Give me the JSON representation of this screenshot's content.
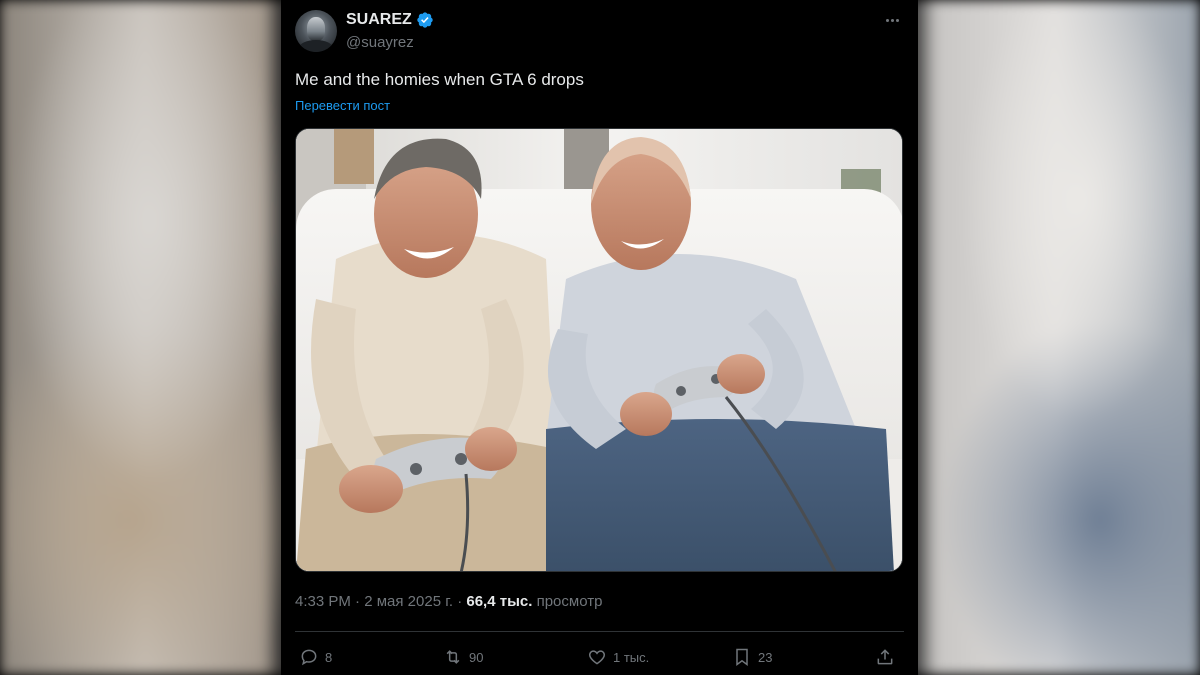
{
  "post": {
    "author": {
      "display_name": "SUAREZ",
      "handle": "@suayrez",
      "verified": true
    },
    "text": "Me and the homies when GTA 6 drops",
    "translate_label": "Перевести пост",
    "image_alt": "Two older men laughing while playing video games with controllers on a white sofa",
    "meta": {
      "time": "4:33 PM",
      "separator1": " · ",
      "date": "2 мая 2025 г.",
      "separator2": " · ",
      "views_count": "66,4 тыс.",
      "views_label": " просмотр"
    },
    "actions": {
      "replies": "8",
      "reposts": "90",
      "likes": "1 тыс.",
      "bookmarks": "23"
    }
  },
  "colors": {
    "background": "#000000",
    "text_primary": "#e7e9ea",
    "text_secondary": "#71767b",
    "link": "#1d9bf0",
    "verified": "#1d9bf0",
    "divider": "#2f3336"
  }
}
